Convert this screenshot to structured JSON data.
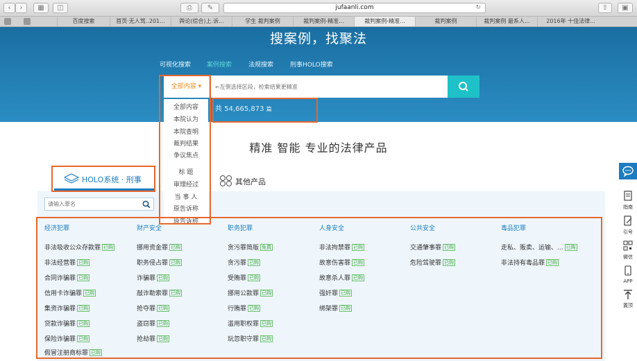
{
  "browser": {
    "url": "jufaanli.com",
    "tabs": [
      "百度搜索",
      "首页·无人驾..201...",
      "舆论(综合)上.诉...",
      "学生 裁判案例",
      "裁判案例-精准...",
      "裁判案例-精准...",
      "裁判案例",
      "裁判案例 最系人...",
      "2016年 十佳法律..."
    ]
  },
  "hero": {
    "title": "搜案例，找聚法",
    "tabs": [
      "可视化搜索",
      "案例搜索",
      "法规搜索",
      "刑事HOLO搜索"
    ],
    "active_tab_index": 1,
    "scope_label": "全部内容",
    "search_placeholder": "←左侧选择区段，检索结果更精准",
    "count_prefix": "共",
    "count": "54,665,873",
    "count_suffix": "篇"
  },
  "dropdown": {
    "items": [
      "全部内容",
      "本院认为",
      "本院查明",
      "裁判结果",
      "争议焦点",
      "标 题",
      "审理经过",
      "当 事 人",
      "原告诉称",
      "原告诉称"
    ]
  },
  "slogan": "精准  智能  专业的法律产品",
  "tabs": {
    "holo": "HOLO系统 · 刑事",
    "other": "其他产品"
  },
  "crime_search": {
    "placeholder": "请输入罪名"
  },
  "categories": [
    {
      "name": "经济犯罪",
      "items": [
        {
          "name": "非法吸收公众存款罪",
          "tag": "已购"
        },
        {
          "name": "非法经营罪",
          "tag": "已购"
        },
        {
          "name": "合同诈骗罪",
          "tag": "已购"
        },
        {
          "name": "信用卡诈骗罪",
          "tag": "已购"
        },
        {
          "name": "集资诈骗罪",
          "tag": "已购"
        },
        {
          "name": "贷款诈骗罪",
          "tag": "已购"
        },
        {
          "name": "保险诈骗罪",
          "tag": "已购"
        },
        {
          "name": "假冒注册商标罪",
          "tag": "已购"
        }
      ]
    },
    {
      "name": "财产安全",
      "items": [
        {
          "name": "挪用资金罪",
          "tag": "已购"
        },
        {
          "name": "职务侵占罪",
          "tag": "已购"
        },
        {
          "name": "诈骗罪",
          "tag": "已购"
        },
        {
          "name": "敲诈勒索罪",
          "tag": "已购"
        },
        {
          "name": "抢夺罪",
          "tag": "已购"
        },
        {
          "name": "盗窃罪",
          "tag": "已购"
        },
        {
          "name": "抢劫罪",
          "tag": "已购"
        }
      ]
    },
    {
      "name": "职务犯罪",
      "items": [
        {
          "name": "贪污罪简版",
          "tag": "免费"
        },
        {
          "name": "贪污罪",
          "tag": "已购"
        },
        {
          "name": "受贿罪",
          "tag": "已购"
        },
        {
          "name": "挪用公款罪",
          "tag": "已购"
        },
        {
          "name": "行贿罪",
          "tag": "已购"
        },
        {
          "name": "滥用职权罪",
          "tag": "已购"
        },
        {
          "name": "玩忽职守罪",
          "tag": "已购"
        }
      ]
    },
    {
      "name": "人身安全",
      "items": [
        {
          "name": "非法拘禁罪",
          "tag": "已购"
        },
        {
          "name": "故意伤害罪",
          "tag": "已购"
        },
        {
          "name": "故意杀人罪",
          "tag": "已购"
        },
        {
          "name": "强奸罪",
          "tag": "已购"
        },
        {
          "name": "绑架罪",
          "tag": "已购"
        }
      ]
    },
    {
      "name": "公共安全",
      "items": [
        {
          "name": "交通肇事罪",
          "tag": "已购"
        },
        {
          "name": "危险驾驶罪",
          "tag": "已购"
        }
      ]
    },
    {
      "name": "毒品犯罪",
      "items": [
        {
          "name": "走私、贩卖、运输、...",
          "tag": "已购"
        },
        {
          "name": "非法持有毒品罪",
          "tag": "已购"
        }
      ]
    }
  ],
  "right_bar": {
    "items": [
      "指南",
      "引号",
      "微信",
      "APP",
      "置顶"
    ]
  },
  "colors": {
    "hero_blue": "#1a6ea1",
    "accent_teal": "#1ec1c8",
    "highlight_orange": "#e8662c",
    "link_blue": "#1d7cbf",
    "tag_green": "#3aa83a"
  }
}
